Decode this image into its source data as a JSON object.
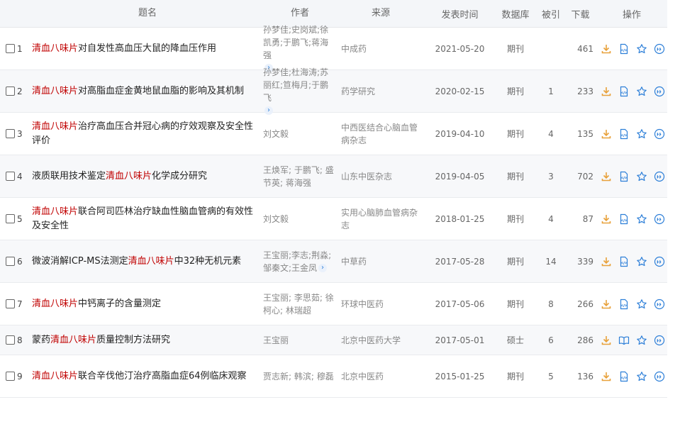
{
  "header": {
    "title": "题名",
    "author": "作者",
    "source": "来源",
    "date": "发表时间",
    "database": "数据库",
    "cited": "被引",
    "downloads": "下载",
    "actions": "操作"
  },
  "icons": {
    "download": "download-icon",
    "html_read": "html-read-icon",
    "book_read": "book-read-icon",
    "favorite": "star-icon",
    "quote": "quote-icon",
    "more": "chevron-right-icon"
  },
  "colors": {
    "highlight": "#c00000",
    "icon_orange": "#e8a13a",
    "icon_blue": "#2d7fd8"
  },
  "rows": [
    {
      "num": "1",
      "title_pre": "",
      "title_hl": "清血八味片",
      "title_post": "对自发性高血压大鼠的降血压作用",
      "author": "孙梦佳;史岗斌;徐凯勇;于鹏飞;蒋海强",
      "source": "中成药",
      "date": "2021-05-20",
      "db": "期刊",
      "cited": "",
      "downloads": "461"
    },
    {
      "num": "2",
      "title_pre": "",
      "title_hl": "清血八味片",
      "title_post": "对高脂血症金黄地鼠血脂的影响及其机制",
      "author": "孙梦佳;杜海涛;苏丽红;笪梅月;于鹏飞",
      "source": "药学研究",
      "date": "2020-02-15",
      "db": "期刊",
      "cited": "1",
      "downloads": "233"
    },
    {
      "num": "3",
      "title_pre": "",
      "title_hl": "清血八味片",
      "title_post": "治疗高血压合并冠心病的疗效观察及安全性评价",
      "author": "刘文毅",
      "source": "中西医结合心脑血管病杂志",
      "date": "2019-04-10",
      "db": "期刊",
      "cited": "4",
      "downloads": "135"
    },
    {
      "num": "4",
      "title_pre": "液质联用技术鉴定",
      "title_hl": "清血八味片",
      "title_post": "化学成分研究",
      "author": "王焕军; 于鹏飞; 盛节英; 蒋海强",
      "source": "山东中医杂志",
      "date": "2019-04-05",
      "db": "期刊",
      "cited": "3",
      "downloads": "702"
    },
    {
      "num": "5",
      "title_pre": "",
      "title_hl": "清血八味片",
      "title_post": "联合阿司匹林治疗缺血性脑血管病的有效性及安全性",
      "author": "刘文毅",
      "source": "实用心脑肺血管病杂志",
      "date": "2018-01-25",
      "db": "期刊",
      "cited": "4",
      "downloads": "87"
    },
    {
      "num": "6",
      "title_pre": "微波消解ICP-MS法测定",
      "title_hl": "清血八味片",
      "title_post": "中32种无机元素",
      "author": "王宝丽;李志;荆淼;邹秦文;王金凤",
      "source": "中草药",
      "date": "2017-05-28",
      "db": "期刊",
      "cited": "14",
      "downloads": "339"
    },
    {
      "num": "7",
      "title_pre": "",
      "title_hl": "清血八味片",
      "title_post": "中钙离子的含量测定",
      "author": "王宝丽; 李思茹; 徐柯心; 林瑞超",
      "source": "环球中医药",
      "date": "2017-05-06",
      "db": "期刊",
      "cited": "8",
      "downloads": "266"
    },
    {
      "num": "8",
      "title_pre": "蒙药",
      "title_hl": "清血八味片",
      "title_post": "质量控制方法研究",
      "author": "王宝丽",
      "source": "北京中医药大学",
      "date": "2017-05-01",
      "db": "硕士",
      "cited": "6",
      "downloads": "286"
    },
    {
      "num": "9",
      "title_pre": "",
      "title_hl": "清血八味片",
      "title_post": "联合辛伐他汀治疗高脂血症64例临床观察",
      "author": "贾志新; 韩滨; 穆磊",
      "source": "北京中医药",
      "date": "2015-01-25",
      "db": "期刊",
      "cited": "5",
      "downloads": "136"
    }
  ]
}
